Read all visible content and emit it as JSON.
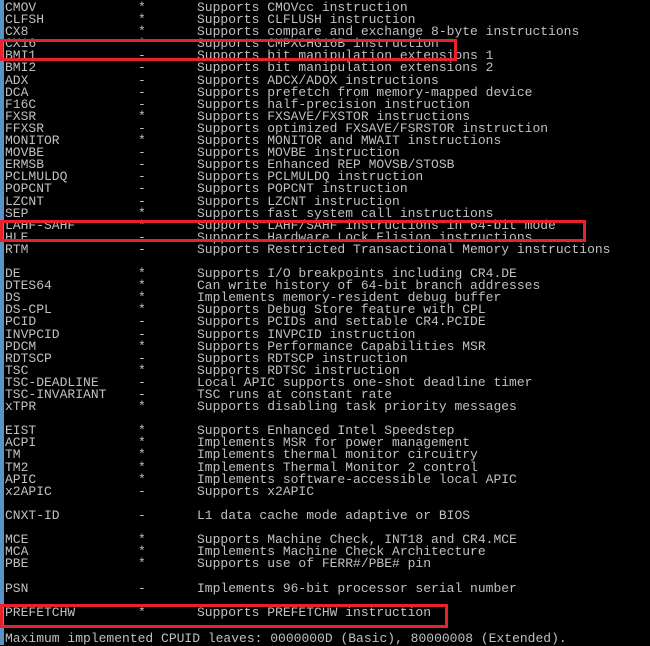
{
  "accent": {
    "highlight_color": "#e8212b",
    "text_color": "#c0c0c0",
    "background": "#000000",
    "left_strip": "#5a93c8"
  },
  "rows": [
    {
      "name": "CMOV",
      "flag": "*",
      "desc": "Supports CMOVcc instruction"
    },
    {
      "name": "CLFSH",
      "flag": "*",
      "desc": "Supports CLFLUSH instruction"
    },
    {
      "name": "CX8",
      "flag": "*",
      "desc": "Supports compare and exchange 8-byte instructions"
    },
    {
      "name": "CX16",
      "flag": "*",
      "desc": "Supports CMPXCHG16B instruction"
    },
    {
      "name": "BMI1",
      "flag": "-",
      "desc": "Supports bit manipulation extensions 1"
    },
    {
      "name": "BMI2",
      "flag": "-",
      "desc": "Supports bit manipulation extensions 2"
    },
    {
      "name": "ADX",
      "flag": "-",
      "desc": "Supports ADCX/ADOX instructions"
    },
    {
      "name": "DCA",
      "flag": "-",
      "desc": "Supports prefetch from memory-mapped device"
    },
    {
      "name": "F16C",
      "flag": "-",
      "desc": "Supports half-precision instruction"
    },
    {
      "name": "FXSR",
      "flag": "*",
      "desc": "Supports FXSAVE/FXSTOR instructions"
    },
    {
      "name": "FFXSR",
      "flag": "-",
      "desc": "Supports optimized FXSAVE/FSRSTOR instruction"
    },
    {
      "name": "MONITOR",
      "flag": "*",
      "desc": "Supports MONITOR and MWAIT instructions"
    },
    {
      "name": "MOVBE",
      "flag": "-",
      "desc": "Supports MOVBE instruction"
    },
    {
      "name": "ERMSB",
      "flag": "-",
      "desc": "Supports Enhanced REP MOVSB/STOSB"
    },
    {
      "name": "PCLMULDQ",
      "flag": "-",
      "desc": "Supports PCLMULDQ instruction"
    },
    {
      "name": "POPCNT",
      "flag": "-",
      "desc": "Supports POPCNT instruction"
    },
    {
      "name": "LZCNT",
      "flag": "-",
      "desc": "Supports LZCNT instruction"
    },
    {
      "name": "SEP",
      "flag": "*",
      "desc": "Supports fast system call instructions"
    },
    {
      "name": "LAHF-SAHF",
      "flag": "*",
      "desc": "Supports LAHF/SAHF instructions in 64-bit mode"
    },
    {
      "name": "HLE",
      "flag": "-",
      "desc": "Supports Hardware Lock Elision instructions"
    },
    {
      "name": "RTM",
      "flag": "-",
      "desc": "Supports Restricted Transactional Memory instructions"
    },
    {
      "blank": true
    },
    {
      "name": "DE",
      "flag": "*",
      "desc": "Supports I/O breakpoints including CR4.DE"
    },
    {
      "name": "DTES64",
      "flag": "*",
      "desc": "Can write history of 64-bit branch addresses"
    },
    {
      "name": "DS",
      "flag": "*",
      "desc": "Implements memory-resident debug buffer"
    },
    {
      "name": "DS-CPL",
      "flag": "*",
      "desc": "Supports Debug Store feature with CPL"
    },
    {
      "name": "PCID",
      "flag": "-",
      "desc": "Supports PCIDs and settable CR4.PCIDE"
    },
    {
      "name": "INVPCID",
      "flag": "-",
      "desc": "Supports INVPCID instruction"
    },
    {
      "name": "PDCM",
      "flag": "*",
      "desc": "Supports Performance Capabilities MSR"
    },
    {
      "name": "RDTSCP",
      "flag": "-",
      "desc": "Supports RDTSCP instruction"
    },
    {
      "name": "TSC",
      "flag": "*",
      "desc": "Supports RDTSC instruction"
    },
    {
      "name": "TSC-DEADLINE",
      "flag": "-",
      "desc": "Local APIC supports one-shot deadline timer"
    },
    {
      "name": "TSC-INVARIANT",
      "flag": "-",
      "desc": "TSC runs at constant rate"
    },
    {
      "name": "xTPR",
      "flag": "*",
      "desc": "Supports disabling task priority messages"
    },
    {
      "blank": true
    },
    {
      "name": "EIST",
      "flag": "*",
      "desc": "Supports Enhanced Intel Speedstep"
    },
    {
      "name": "ACPI",
      "flag": "*",
      "desc": "Implements MSR for power management"
    },
    {
      "name": "TM",
      "flag": "*",
      "desc": "Implements thermal monitor circuitry"
    },
    {
      "name": "TM2",
      "flag": "*",
      "desc": "Implements Thermal Monitor 2 control"
    },
    {
      "name": "APIC",
      "flag": "*",
      "desc": "Implements software-accessible local APIC"
    },
    {
      "name": "x2APIC",
      "flag": "-",
      "desc": "Supports x2APIC"
    },
    {
      "blank": true
    },
    {
      "name": "CNXT-ID",
      "flag": "-",
      "desc": "L1 data cache mode adaptive or BIOS"
    },
    {
      "blank": true
    },
    {
      "name": "MCE",
      "flag": "*",
      "desc": "Supports Machine Check, INT18 and CR4.MCE"
    },
    {
      "name": "MCA",
      "flag": "*",
      "desc": "Implements Machine Check Architecture"
    },
    {
      "name": "PBE",
      "flag": "*",
      "desc": "Supports use of FERR#/PBE# pin"
    },
    {
      "blank": true
    },
    {
      "name": "PSN",
      "flag": "-",
      "desc": "Implements 96-bit processor serial number"
    },
    {
      "blank": true
    },
    {
      "name": "PREFETCHW",
      "flag": "*",
      "desc": "Supports PREFETCHW instruction"
    }
  ],
  "footer": "Maximum implemented CPUID leaves: 0000000D (Basic), 80000008 (Extended).",
  "highlights": [
    "CX16",
    "LAHF-SAHF",
    "PREFETCHW"
  ]
}
